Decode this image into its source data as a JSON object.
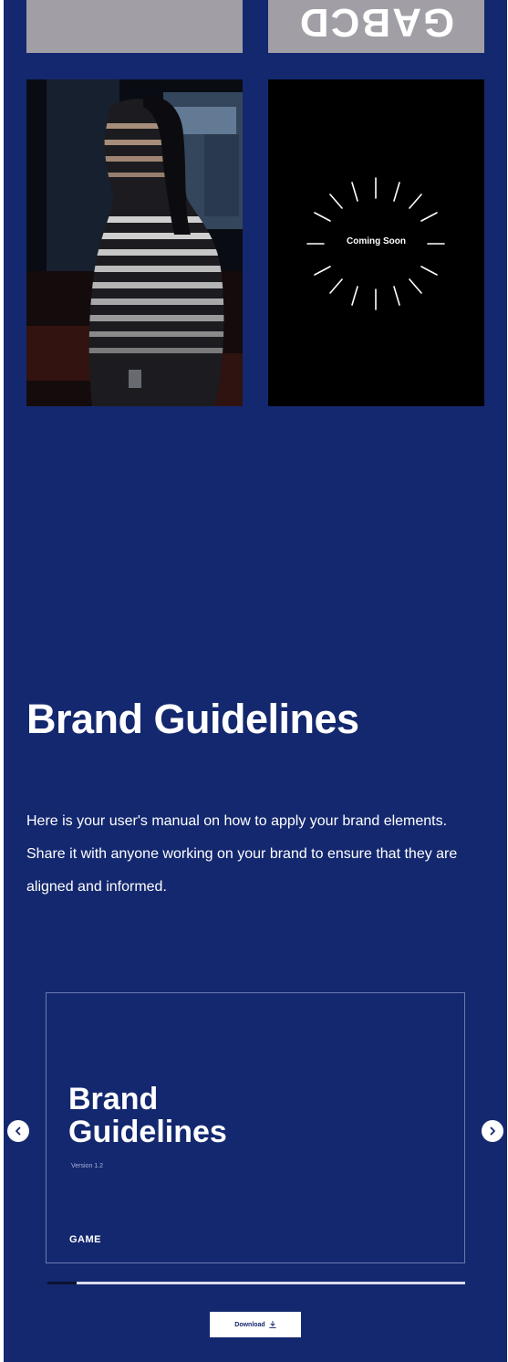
{
  "top_tiles": {
    "mirrored_letters": "GABCD"
  },
  "coming_soon": {
    "label": "Coming Soon"
  },
  "hero": {
    "title": "Brand Guidelines",
    "description": "Here is your user's manual on how to apply your brand elements. Share it with anyone working on your brand to ensure that they are aligned and informed."
  },
  "carousel": {
    "card": {
      "title_line1": "Brand",
      "title_line2": "Guidelines",
      "version": "Version 1.2",
      "brand": "GAME"
    },
    "prev_icon": "chevron-left-icon",
    "next_icon": "chevron-right-icon",
    "progress_fraction": 0.07
  },
  "download": {
    "label": "Download",
    "icon": "download-icon"
  },
  "colors": {
    "background": "#14286f",
    "tile_grey": "#a19fa5",
    "text": "#ffffff"
  }
}
